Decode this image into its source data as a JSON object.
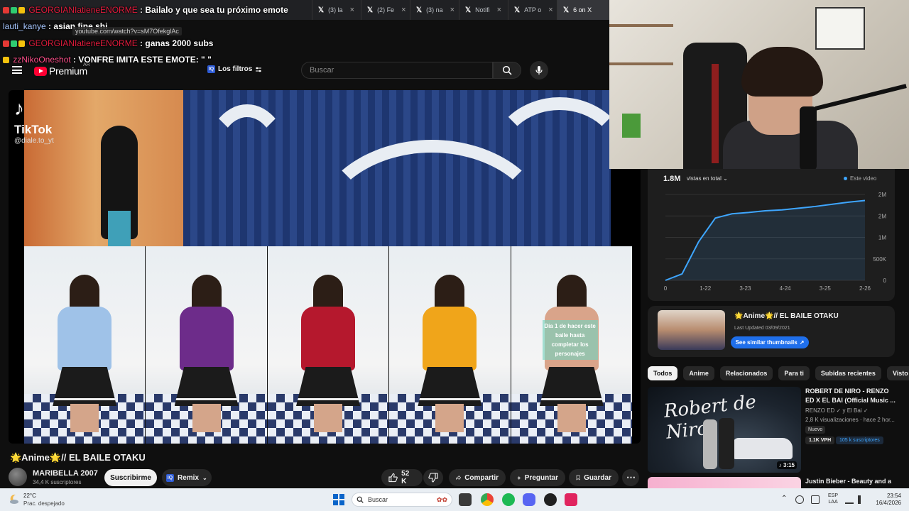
{
  "browser": {
    "tabs": [
      {
        "label": "",
        "active": false
      },
      {
        "label": "(3) la",
        "active": false
      },
      {
        "label": "(2) Fe",
        "active": false
      },
      {
        "label": "(3) na",
        "active": false
      },
      {
        "label": "Notifi",
        "active": false
      },
      {
        "label": "ATP o",
        "active": false
      },
      {
        "label": "6 on X",
        "active": true
      }
    ],
    "hover_url": "youtube.com/watch?v=sM7OfekglAc"
  },
  "chat": [
    {
      "user": "GEORGIANIatieneENORME",
      "message": "Bailalo y que sea tu próximo emote",
      "user_color": "#e01b3c"
    },
    {
      "user": "lauti_kanye",
      "message": "asian fine shi",
      "user_color": "#a8c8ff"
    },
    {
      "user": "GEORGIANIatieneENORME",
      "message": "ganas 2000 subs",
      "user_color": "#e01b3c"
    },
    {
      "user": "zzNikoOneshot",
      "message": "VONFRE IMITA ESTE EMOTE: \" \"",
      "user_color": "#ff4f8b"
    }
  ],
  "header": {
    "logo_text": "Premium",
    "region": "AR",
    "filters_label": "Los filtros",
    "search_placeholder": "Buscar"
  },
  "video": {
    "tiktok_word": "TikTok",
    "tiktok_handle": "@diale.to_yt",
    "caption": "Día 1 de hacer este baile hasta completar los personajes"
  },
  "info": {
    "title": "🌟Anime🌟// EL BAILE OTAKU",
    "channel": "MARIBELLA 2007",
    "subscribers": "34,4 K suscriptores",
    "subscribe_label": "Suscribirme",
    "remix_label": "Remix",
    "likes": "52 K",
    "share_label": "Compartir",
    "ask_label": "Preguntar",
    "save_label": "Guardar"
  },
  "analytics": {
    "total_views": "1.8M",
    "views_select": "vistas en total",
    "legend": "Este video",
    "chart_data": {
      "type": "line",
      "x_ticks": [
        "0",
        "1-22",
        "3-23",
        "4-24",
        "3-25",
        "2-26"
      ],
      "y_ticks": [
        "0",
        "500K",
        "1M",
        "2M",
        "2M"
      ],
      "series": [
        {
          "name": "Este video",
          "color": "#3ea6ff",
          "values": [
            0,
            0.15,
            0.9,
            1.45,
            1.55,
            1.58,
            1.62,
            1.64,
            1.68,
            1.72,
            1.77,
            1.82,
            1.86
          ]
        }
      ],
      "ylim": [
        0,
        2.0
      ]
    }
  },
  "related_card": {
    "title": "🌟Anime🌟// EL BAILE OTAKU",
    "updated": "Last Updated 03/09/2021",
    "button_label": "See similar thumbnails"
  },
  "chips": [
    "Todos",
    "Anime",
    "Relacionados",
    "Para ti",
    "Subidas recientes",
    "Visto"
  ],
  "recommended": [
    {
      "title": "ROBERT DE NIRO - RENZO ED X EL BAI (Official Music ...",
      "channel": "RENZO ED ✓ y El Bai ✓",
      "meta": "2,8 K visualizaciones · hace 2 hor...",
      "badge": "Nuevo",
      "vph": "1.1K VPH",
      "subs": "105 k suscriptores",
      "duration": "3:15",
      "thumb_text": "Robert de Niro"
    },
    {
      "title": "Justin Bieber - Beauty and a"
    }
  ],
  "taskbar": {
    "temperature": "22°C",
    "weather": "Prac. despejado",
    "search_label": "Buscar",
    "lang_top": "ESP",
    "lang_bottom": "LAA",
    "time": "23:54",
    "date": "16/4/2026"
  }
}
